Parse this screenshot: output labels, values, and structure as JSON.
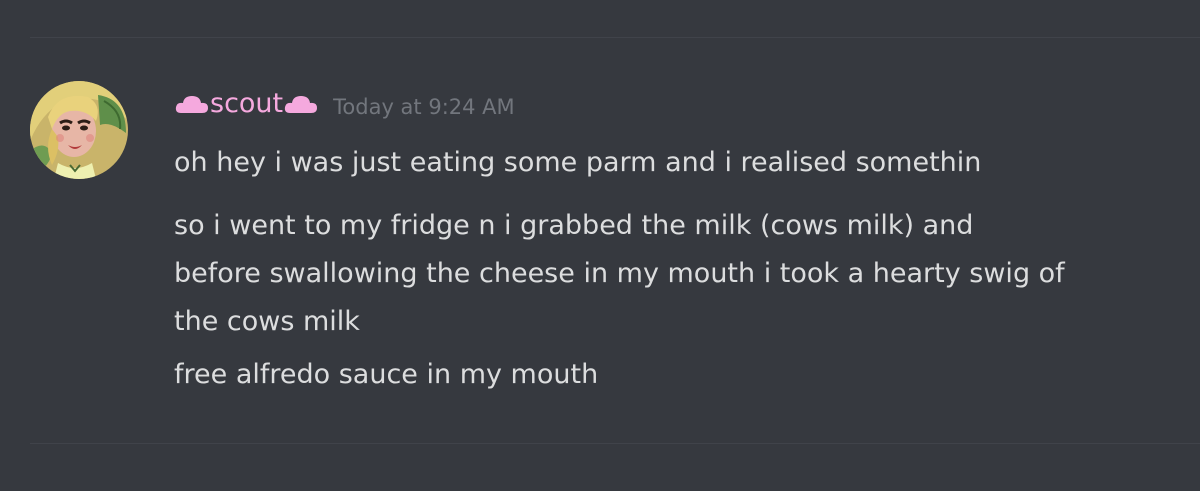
{
  "message_group": {
    "author": {
      "name": "scout",
      "name_color": "#f5a9de",
      "decoration_icon": "cloud-icon",
      "avatar_icon": "avatar-illustration"
    },
    "timestamp": "Today at 9:24 AM",
    "messages": [
      "oh hey i was just eating some parm and i realised somethin",
      "so i went to my fridge n i grabbed the milk (cows milk) and\nbefore swallowing the cheese in my mouth i took a hearty swig of\nthe cows milk",
      "free alfredo sauce in my mouth"
    ]
  },
  "colors": {
    "background": "#36393f",
    "text": "#dcddde",
    "timestamp": "#72767d",
    "divider": "#40434a"
  }
}
